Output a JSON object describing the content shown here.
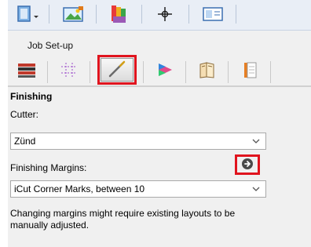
{
  "toolbar": {
    "buttons": [
      {
        "name": "page-setup-dropdown-button",
        "icon": "page-icon"
      },
      {
        "name": "image-import-button",
        "icon": "image-icon"
      },
      {
        "name": "color-profile-button",
        "icon": "color-swatch-icon"
      },
      {
        "name": "registration-button",
        "icon": "crosshair-icon"
      },
      {
        "name": "layout-view-button",
        "icon": "layout-icon"
      }
    ]
  },
  "panel": {
    "title": "Job Set-up",
    "tabs": [
      {
        "name": "tab-media",
        "icon": "media-stack-icon"
      },
      {
        "name": "tab-grid",
        "icon": "grid-dots-icon"
      },
      {
        "name": "tab-finishing",
        "icon": "cutter-knife-icon",
        "active": true
      },
      {
        "name": "tab-color",
        "icon": "color-prism-icon"
      },
      {
        "name": "tab-book",
        "icon": "book-icon"
      },
      {
        "name": "tab-document",
        "icon": "document-icon"
      }
    ]
  },
  "finishing": {
    "section_title": "Finishing",
    "cutter_label": "Cutter:",
    "cutter_value": "Zünd",
    "margins_label": "Finishing Margins:",
    "margins_value": "iCut Corner Marks, between 10",
    "note": "Changing margins might require existing layouts to be manually adjusted."
  },
  "colors": {
    "highlight": "#e0141e",
    "toolbar_bg": "#e9eef6",
    "panel_bg": "#f0f0f0"
  }
}
